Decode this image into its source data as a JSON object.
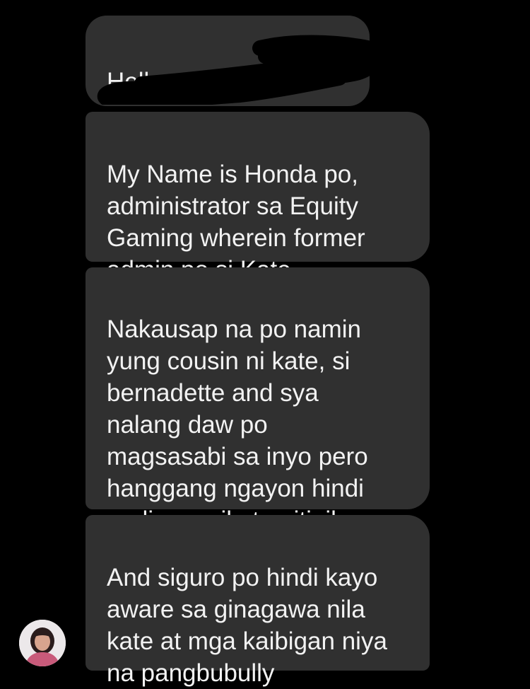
{
  "messages": [
    {
      "text": "Hello po Ms."
    },
    {
      "text": "My Name is Honda po,\nadministrator sa Equity\nGaming wherein former\nadmin po si Kate"
    },
    {
      "text": "Nakausap na po namin\nyung cousin ni kate, si\nbernadette and sya\nnalang daw po\nmagsasabi sa inyo pero\nhanggang ngayon hindi\npadin po sila tumitigil"
    },
    {
      "text": "And siguro po hindi kayo\naware sa ginagawa nila\nkate at mga kaibigan niya\nna pangbubully"
    }
  ],
  "colors": {
    "background": "#000000",
    "bubble": "#303030",
    "text": "#f2f2f2",
    "redaction": "#000000"
  },
  "icons": {
    "avatar": "sender-avatar"
  }
}
